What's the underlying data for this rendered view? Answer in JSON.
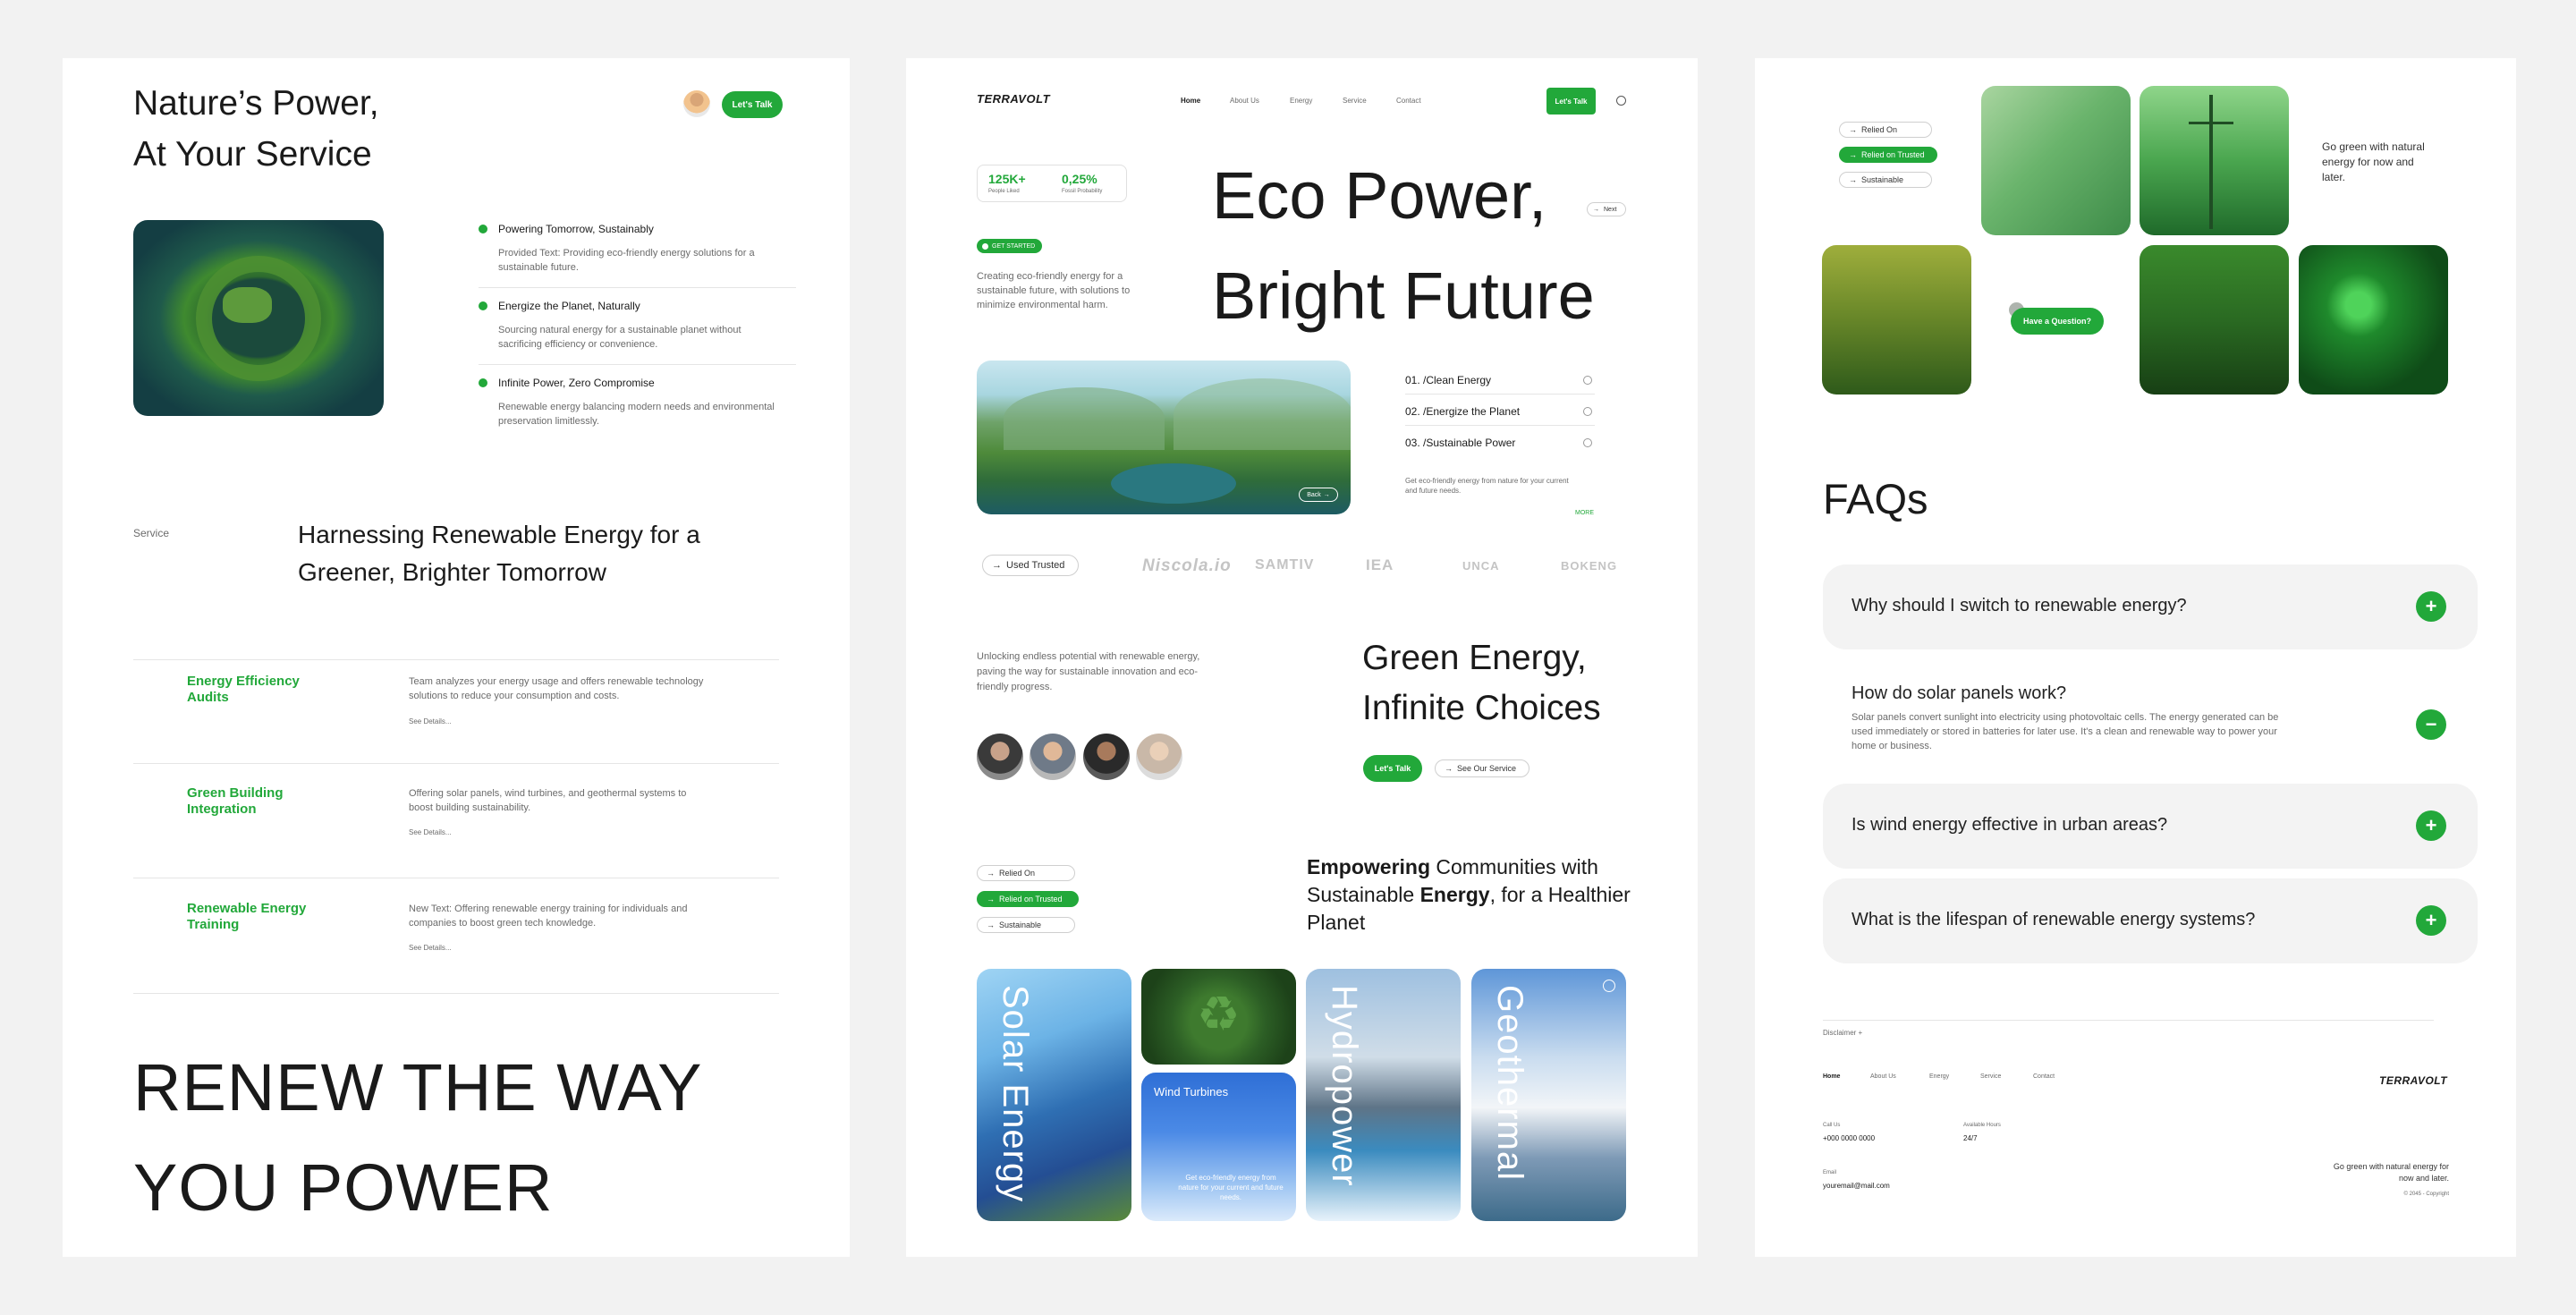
{
  "panel1": {
    "hero_title_line1": "Nature’s Power,",
    "hero_title_line2": "At Your Service",
    "lets_talk": "Let's Talk",
    "features": [
      {
        "title": "Powering Tomorrow, Sustainably",
        "desc": "Provided Text: Providing eco-friendly energy solutions for a sustainable future."
      },
      {
        "title": "Energize the Planet, Naturally",
        "desc": "Sourcing natural energy for a sustainable planet without sacrificing efficiency or convenience."
      },
      {
        "title": "Infinite Power, Zero Compromise",
        "desc": "Renewable energy balancing modern needs and environmental preservation limitlessly."
      }
    ],
    "service_label": "Service",
    "service_heading": "Harnessing Renewable Energy for a Greener, Brighter Tomorrow",
    "services": [
      {
        "title": "Energy Efficiency Audits",
        "desc": "Team analyzes your energy usage and offers renewable technology solutions to reduce your consumption and costs.",
        "link": "See Details..."
      },
      {
        "title": "Green Building Integration",
        "desc": "Offering solar panels, wind turbines, and geothermal systems to boost building sustainability.",
        "link": "See Details..."
      },
      {
        "title": "Renewable Energy Training",
        "desc": "New Text: Offering renewable energy training for individuals and companies to boost green tech knowledge.",
        "link": "See Details..."
      }
    ],
    "renew_line1": "RENEW THE WAY",
    "renew_line2": "YOU POWER"
  },
  "panel2": {
    "logo": "TERRAVOLT",
    "nav": [
      "Home",
      "About Us",
      "Energy",
      "Service",
      "Contact"
    ],
    "lets_talk": "Let's Talk",
    "stats": [
      {
        "value": "125K+",
        "label": "People Liked"
      },
      {
        "value": "0,25%",
        "label": "Fossil Probability"
      }
    ],
    "get_started": "GET STARTED",
    "intro": "Creating eco-friendly energy for a sustainable future, with solutions to minimize environmental harm.",
    "hero_line1": "Eco Power,",
    "hero_line2": "Bright Future",
    "next_label": "Next",
    "back_label": "Back",
    "list": [
      "01. /Clean Energy",
      "02. /Energize the Planet",
      "03. /Sustainable Power"
    ],
    "list_desc": "Get eco-friendly energy from nature for your current and future needs.",
    "more": "MORE",
    "used_trusted": "Used Trusted",
    "brands": [
      "Niscola.io",
      "SAMTIV",
      "IEA",
      "UNCA",
      "BOKENG"
    ],
    "unlock_text": "Unlocking endless potential with renewable energy, paving the way for sustainable innovation and eco-friendly progress.",
    "green_line1": "Green Energy,",
    "green_line2": "Infinite Choices",
    "lets_talk2": "Let's Talk",
    "see_service": "See Our Service",
    "tags": [
      "Relied On",
      "Relied on Trusted",
      "Sustainable"
    ],
    "emp_bold1": "Empowering",
    "emp_text1": " Communities with Sustainable ",
    "emp_bold2": "Energy",
    "emp_text2": ", for a Healthier Planet",
    "cards": {
      "solar": "Solar Energy",
      "wind": "Wind Turbines",
      "wind_desc": "Get eco-friendly energy from nature for your current and future needs.",
      "hydro": "Hydropower",
      "geo": "Geothermal"
    }
  },
  "panel3": {
    "tags": [
      "Relied On",
      "Relied on Trusted",
      "Sustainable"
    ],
    "go_green": "Go green with natural energy for now and later.",
    "question_btn": "Have a Question?",
    "faq_title": "FAQs",
    "faqs": [
      {
        "q": "Why should I switch to renewable energy?",
        "icon": "+"
      },
      {
        "q": "How do solar panels work?",
        "a": "Solar panels convert sunlight into electricity using photovoltaic cells. The energy generated can be used immediately or stored in batteries for later use. It's a clean and renewable way to power your home or business.",
        "icon": "−"
      },
      {
        "q": "Is wind energy effective in urban areas?",
        "icon": "+"
      },
      {
        "q": "What is the lifespan of renewable energy systems?",
        "icon": "+"
      }
    ],
    "disclaimer": "Disclaimer +",
    "footer_nav": [
      "Home",
      "About Us",
      "Energy",
      "Service",
      "Contact"
    ],
    "logo": "TERRAVOLT",
    "call_label": "Call Us",
    "call_value": "+000 0000 0000",
    "hours_label": "Available Hours",
    "hours_value": "24/7",
    "email_label": "Email",
    "email_value": "youremail@mail.com",
    "footer_tagline": "Go green with natural energy for now and later.",
    "copyright": "© 2045 - Copyright"
  }
}
